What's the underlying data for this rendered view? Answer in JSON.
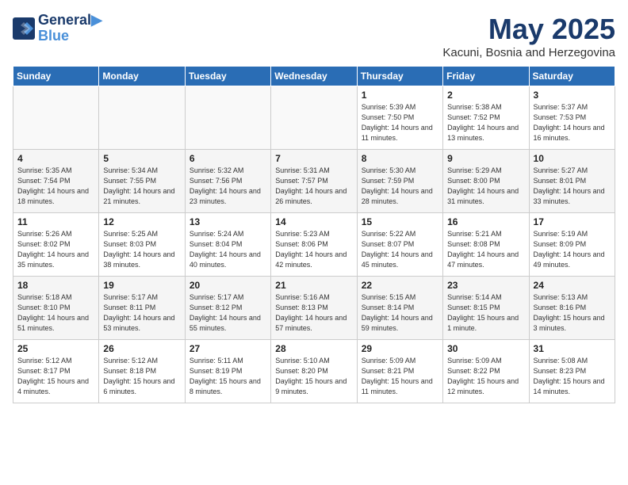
{
  "header": {
    "logo_line1": "General",
    "logo_line2": "Blue",
    "month": "May 2025",
    "location": "Kacuni, Bosnia and Herzegovina"
  },
  "days_of_week": [
    "Sunday",
    "Monday",
    "Tuesday",
    "Wednesday",
    "Thursday",
    "Friday",
    "Saturday"
  ],
  "weeks": [
    [
      {
        "day": "",
        "content": ""
      },
      {
        "day": "",
        "content": ""
      },
      {
        "day": "",
        "content": ""
      },
      {
        "day": "",
        "content": ""
      },
      {
        "day": "1",
        "content": "Sunrise: 5:39 AM\nSunset: 7:50 PM\nDaylight: 14 hours\nand 11 minutes."
      },
      {
        "day": "2",
        "content": "Sunrise: 5:38 AM\nSunset: 7:52 PM\nDaylight: 14 hours\nand 13 minutes."
      },
      {
        "day": "3",
        "content": "Sunrise: 5:37 AM\nSunset: 7:53 PM\nDaylight: 14 hours\nand 16 minutes."
      }
    ],
    [
      {
        "day": "4",
        "content": "Sunrise: 5:35 AM\nSunset: 7:54 PM\nDaylight: 14 hours\nand 18 minutes."
      },
      {
        "day": "5",
        "content": "Sunrise: 5:34 AM\nSunset: 7:55 PM\nDaylight: 14 hours\nand 21 minutes."
      },
      {
        "day": "6",
        "content": "Sunrise: 5:32 AM\nSunset: 7:56 PM\nDaylight: 14 hours\nand 23 minutes."
      },
      {
        "day": "7",
        "content": "Sunrise: 5:31 AM\nSunset: 7:57 PM\nDaylight: 14 hours\nand 26 minutes."
      },
      {
        "day": "8",
        "content": "Sunrise: 5:30 AM\nSunset: 7:59 PM\nDaylight: 14 hours\nand 28 minutes."
      },
      {
        "day": "9",
        "content": "Sunrise: 5:29 AM\nSunset: 8:00 PM\nDaylight: 14 hours\nand 31 minutes."
      },
      {
        "day": "10",
        "content": "Sunrise: 5:27 AM\nSunset: 8:01 PM\nDaylight: 14 hours\nand 33 minutes."
      }
    ],
    [
      {
        "day": "11",
        "content": "Sunrise: 5:26 AM\nSunset: 8:02 PM\nDaylight: 14 hours\nand 35 minutes."
      },
      {
        "day": "12",
        "content": "Sunrise: 5:25 AM\nSunset: 8:03 PM\nDaylight: 14 hours\nand 38 minutes."
      },
      {
        "day": "13",
        "content": "Sunrise: 5:24 AM\nSunset: 8:04 PM\nDaylight: 14 hours\nand 40 minutes."
      },
      {
        "day": "14",
        "content": "Sunrise: 5:23 AM\nSunset: 8:06 PM\nDaylight: 14 hours\nand 42 minutes."
      },
      {
        "day": "15",
        "content": "Sunrise: 5:22 AM\nSunset: 8:07 PM\nDaylight: 14 hours\nand 45 minutes."
      },
      {
        "day": "16",
        "content": "Sunrise: 5:21 AM\nSunset: 8:08 PM\nDaylight: 14 hours\nand 47 minutes."
      },
      {
        "day": "17",
        "content": "Sunrise: 5:19 AM\nSunset: 8:09 PM\nDaylight: 14 hours\nand 49 minutes."
      }
    ],
    [
      {
        "day": "18",
        "content": "Sunrise: 5:18 AM\nSunset: 8:10 PM\nDaylight: 14 hours\nand 51 minutes."
      },
      {
        "day": "19",
        "content": "Sunrise: 5:17 AM\nSunset: 8:11 PM\nDaylight: 14 hours\nand 53 minutes."
      },
      {
        "day": "20",
        "content": "Sunrise: 5:17 AM\nSunset: 8:12 PM\nDaylight: 14 hours\nand 55 minutes."
      },
      {
        "day": "21",
        "content": "Sunrise: 5:16 AM\nSunset: 8:13 PM\nDaylight: 14 hours\nand 57 minutes."
      },
      {
        "day": "22",
        "content": "Sunrise: 5:15 AM\nSunset: 8:14 PM\nDaylight: 14 hours\nand 59 minutes."
      },
      {
        "day": "23",
        "content": "Sunrise: 5:14 AM\nSunset: 8:15 PM\nDaylight: 15 hours\nand 1 minute."
      },
      {
        "day": "24",
        "content": "Sunrise: 5:13 AM\nSunset: 8:16 PM\nDaylight: 15 hours\nand 3 minutes."
      }
    ],
    [
      {
        "day": "25",
        "content": "Sunrise: 5:12 AM\nSunset: 8:17 PM\nDaylight: 15 hours\nand 4 minutes."
      },
      {
        "day": "26",
        "content": "Sunrise: 5:12 AM\nSunset: 8:18 PM\nDaylight: 15 hours\nand 6 minutes."
      },
      {
        "day": "27",
        "content": "Sunrise: 5:11 AM\nSunset: 8:19 PM\nDaylight: 15 hours\nand 8 minutes."
      },
      {
        "day": "28",
        "content": "Sunrise: 5:10 AM\nSunset: 8:20 PM\nDaylight: 15 hours\nand 9 minutes."
      },
      {
        "day": "29",
        "content": "Sunrise: 5:09 AM\nSunset: 8:21 PM\nDaylight: 15 hours\nand 11 minutes."
      },
      {
        "day": "30",
        "content": "Sunrise: 5:09 AM\nSunset: 8:22 PM\nDaylight: 15 hours\nand 12 minutes."
      },
      {
        "day": "31",
        "content": "Sunrise: 5:08 AM\nSunset: 8:23 PM\nDaylight: 15 hours\nand 14 minutes."
      }
    ]
  ]
}
